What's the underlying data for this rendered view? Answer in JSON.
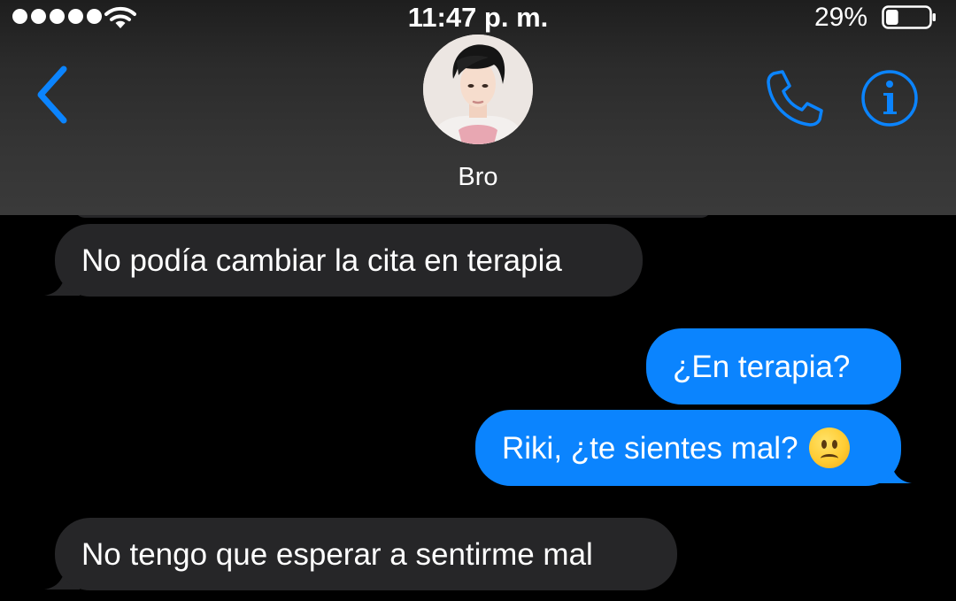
{
  "status_bar": {
    "time": "11:47 p. m.",
    "battery_percent": "29%",
    "battery_level": 0.29,
    "signal_bars": 5,
    "wifi_icon": "wifi-icon"
  },
  "header": {
    "contact_name": "Bro",
    "back_icon": "chevron-left-icon",
    "call_icon": "phone-icon",
    "info_icon": "info-icon",
    "avatar": "contact-photo"
  },
  "colors": {
    "accent": "#0b84fe",
    "incoming_bubble": "#262628",
    "outgoing_bubble": "#0b84fe",
    "background": "#000000",
    "header_background": "#3a3a3a"
  },
  "messages": [
    {
      "direction": "incoming",
      "text": "No podía cambiar la cita en terapia"
    },
    {
      "direction": "outgoing",
      "text": "¿En terapia?"
    },
    {
      "direction": "outgoing",
      "text": "Riki, ¿te sientes mal?",
      "emoji": "slightly-frowning-face"
    },
    {
      "direction": "incoming",
      "text": "No tengo que esperar a sentirme mal"
    }
  ]
}
